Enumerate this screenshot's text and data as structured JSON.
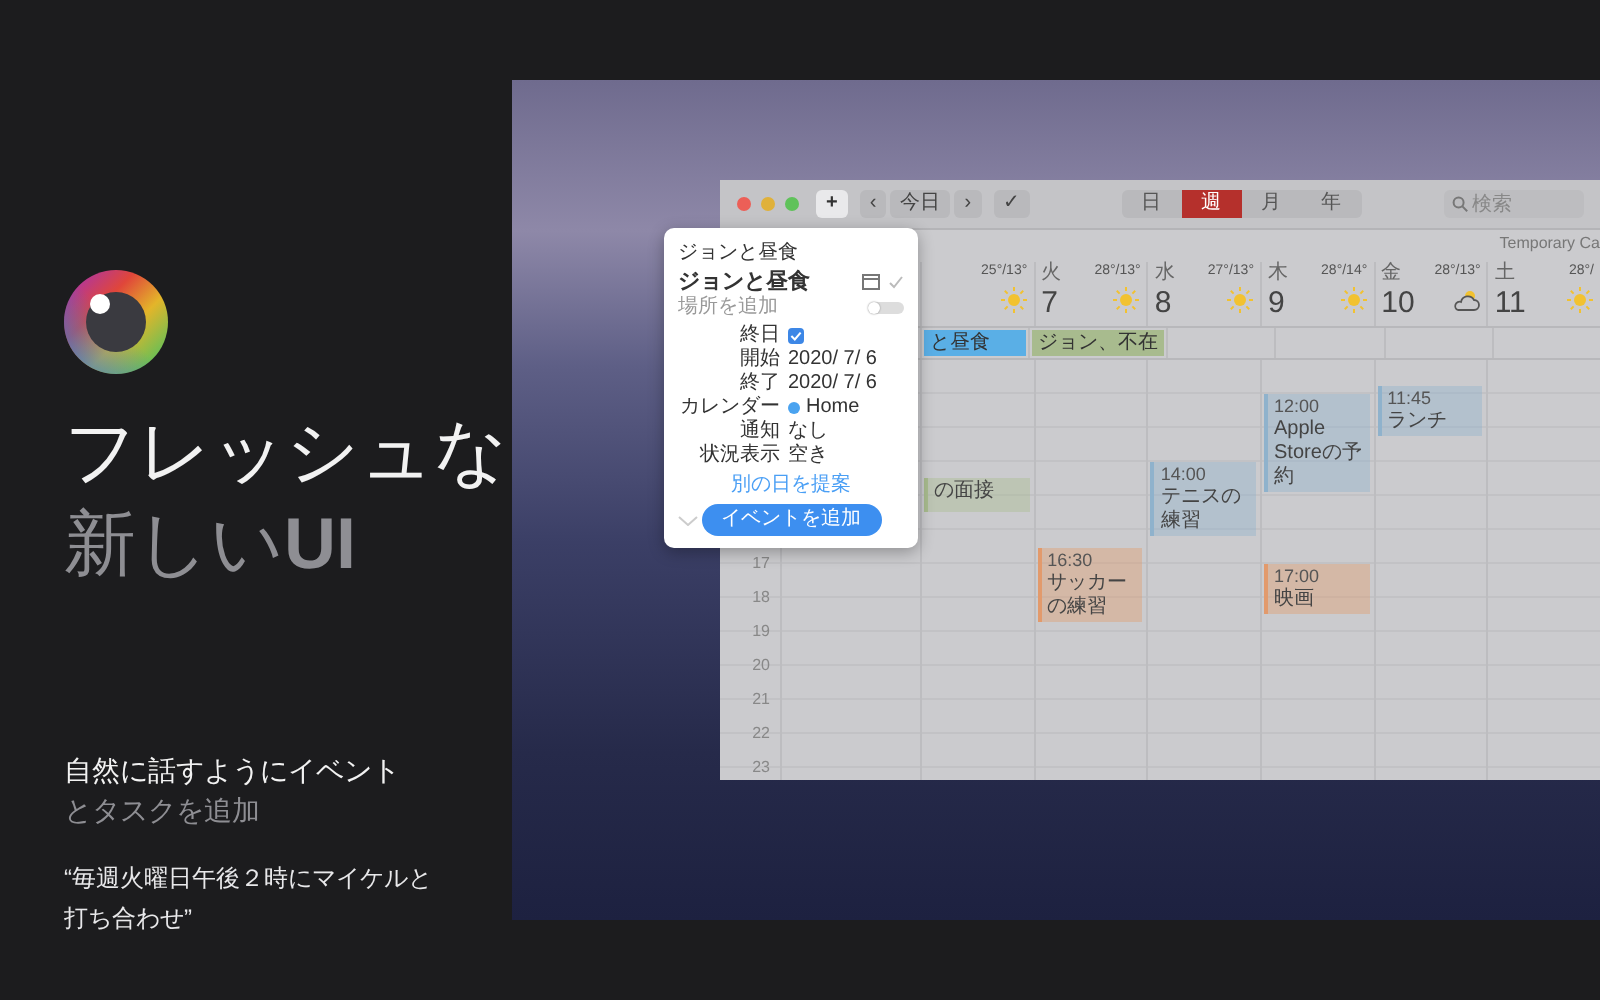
{
  "promo": {
    "headline": {
      "primary": "フレッシュな",
      "secondary": "新しい**UI**"
    },
    "subtitle": {
      "primary": "自然に話すようにイベント",
      "secondary": "とタスクを追加"
    },
    "example": "“毎週火曜日午後２時にマイケルと打ち合わせ”"
  },
  "calendar": {
    "toolbar": {
      "add": "+",
      "prev": "‹",
      "today": "今日",
      "next": "›",
      "done": "✓",
      "view_tabs": [
        {
          "label": "日",
          "selected": false
        },
        {
          "label": "週",
          "selected": true
        },
        {
          "label": "月",
          "selected": false
        },
        {
          "label": "年",
          "selected": false
        }
      ],
      "search": {
        "placeholder": "検索"
      }
    },
    "calendar_name": "Temporary Ca",
    "days": [
      {
        "temp": "25°/13°",
        "kind": "sunny",
        "all_day_events": [
          {
            "title": "と昼食",
            "color": "#5aafe6"
          }
        ],
        "events": [
          {
            "title": "の面接",
            "color": "#a8bb8e"
          }
        ]
      },
      {
        "weekday": "火",
        "day": "7",
        "temp": "28°/13°",
        "kind": "sunny",
        "all_day_events": [
          {
            "title": "ジョン、不在",
            "color": "#a8bb8e"
          }
        ],
        "events": [
          {
            "time": "16:30",
            "title": "サッカーの練習",
            "color": "#e29a6c"
          }
        ]
      },
      {
        "weekday": "水",
        "day": "8",
        "temp": "27°/13°",
        "kind": "sunny",
        "events": [
          {
            "time": "14:00",
            "title": "テニスの練習",
            "color": "#8fb2cc"
          }
        ]
      },
      {
        "weekday": "木",
        "day": "9",
        "temp": "28°/14°",
        "kind": "sunny",
        "events": [
          {
            "time": "12:00",
            "title": "Apple Storeの予約",
            "color": "#8fb2cc"
          },
          {
            "time": "17:00",
            "title": "映画",
            "color": "#e29a6c"
          }
        ]
      },
      {
        "weekday": "金",
        "day": "10",
        "temp": "28°/13°",
        "kind": "cloudy",
        "events": [
          {
            "time": "11:45",
            "title": "ランチ",
            "color": "#8fb2cc"
          }
        ]
      },
      {
        "weekday": "土",
        "day": "11",
        "temp": "28°/",
        "kind": "sunny"
      }
    ],
    "hours": [
      "17",
      "18",
      "19",
      "20",
      "21",
      "22",
      "23"
    ],
    "popover": {
      "input": "ジョンと昼食",
      "title": "ジョンと昼食",
      "location_placeholder": "場所を追加",
      "toggle_on": false,
      "all_day": {
        "label": "終日",
        "checked": true
      },
      "fields": [
        {
          "label": "開始",
          "value": "2020/ 7/ 6"
        },
        {
          "label": "終了",
          "value": "2020/ 7/ 6"
        },
        {
          "label": "カレンダー",
          "value": "Home",
          "color": "#4aa3f0"
        },
        {
          "label": "通知",
          "value": "なし"
        },
        {
          "label": "状況表示",
          "value": "空き"
        }
      ],
      "suggest_link": "別の日を提案",
      "add_button": "イベントを追加"
    }
  }
}
